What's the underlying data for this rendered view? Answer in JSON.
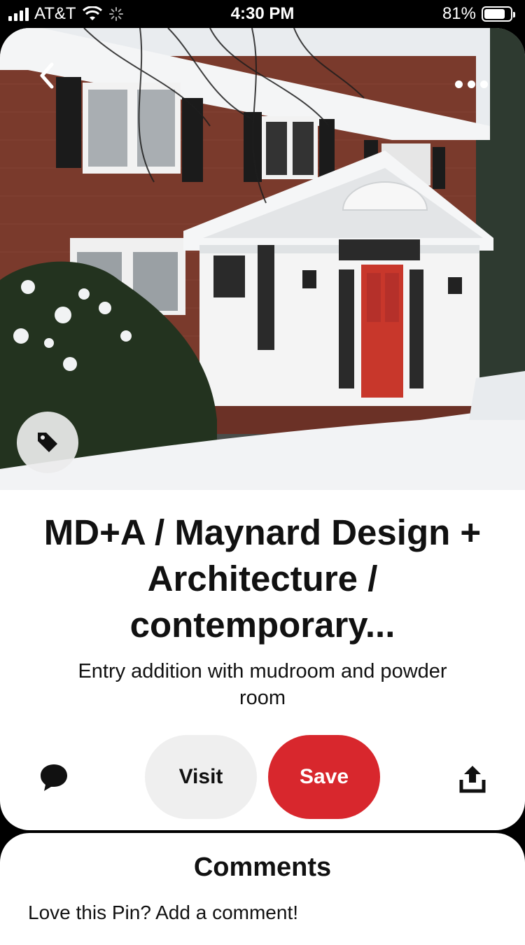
{
  "status_bar": {
    "carrier": "AT&T",
    "time": "4:30 PM",
    "battery": "81%",
    "battery_level": 0.81
  },
  "pin": {
    "title_lines": [
      "MD+A / Maynard Design +",
      "Architecture /",
      "contemporary..."
    ],
    "description_lines": [
      "Entry addition with mudroom and powder",
      "room"
    ]
  },
  "actions": {
    "visit_label": "Visit",
    "save_label": "Save"
  },
  "comments": {
    "title": "Comments",
    "prompt": "Love this Pin? Add a comment!"
  },
  "colors": {
    "save": "#d8272d",
    "visit": "#efefef",
    "text": "#111111"
  },
  "icons": {
    "back": "chevron-left-icon",
    "more": "more-dots-icon",
    "tag": "tag-icon",
    "comment": "speech-bubble-icon",
    "share": "share-upload-icon"
  }
}
